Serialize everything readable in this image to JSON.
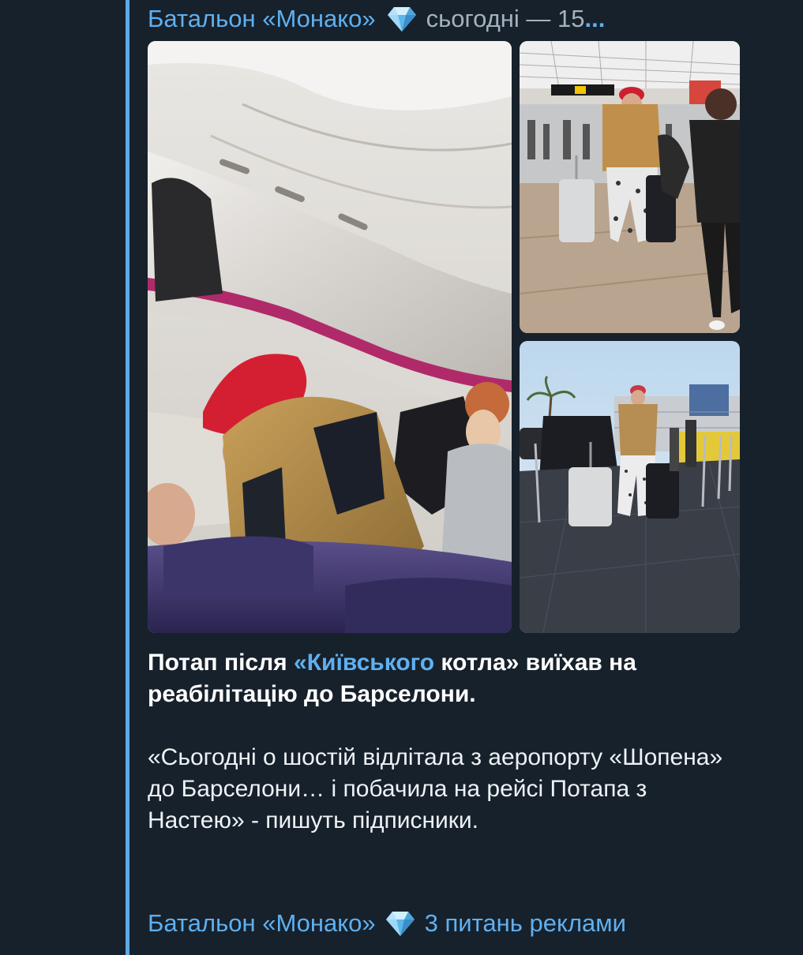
{
  "post": {
    "channel_name": "Батальон «Монако»",
    "time_text": "сьогодні — 15",
    "time_ellipsis": "...",
    "gem_icon": "gem-icon",
    "accent_color": "#5fb0f0",
    "background_color": "#17212b"
  },
  "caption": {
    "headline_part1": "Потап після ",
    "headline_link": "«Київського",
    "headline_part2": " котла» виїхав на реабілітацію до Барселони.",
    "quote_text": "«Сьогодні о шостій відлітала з аеропорту «Шопена» до Барселони… і побачила на рейсі Потапа з Настею» - пишуть підписники."
  },
  "footer": {
    "channel_link": "Батальон «Монако»",
    "ads_link": "3 питань реклами"
  }
}
